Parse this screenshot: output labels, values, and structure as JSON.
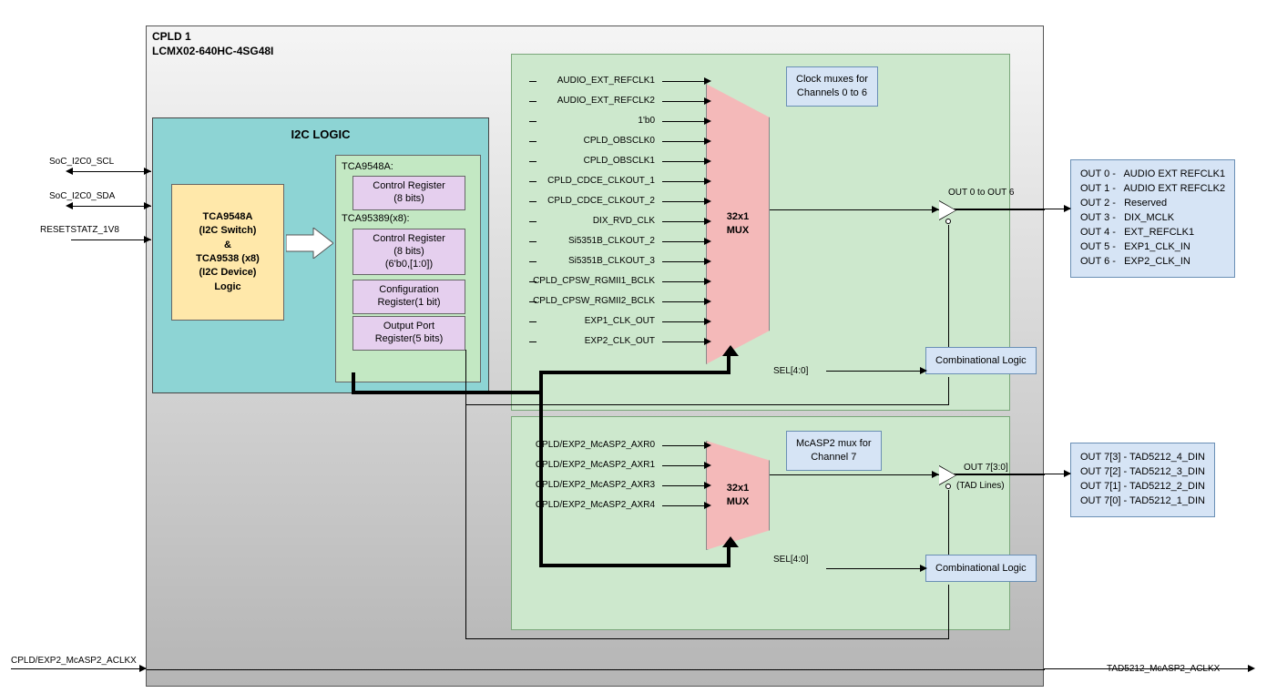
{
  "cpld": {
    "title_l1": "CPLD 1",
    "title_l2": "LCMX02-640HC-4SG48I"
  },
  "ext_inputs": {
    "scl": "SoC_I2C0_SCL",
    "sda": "SoC_I2C0_SDA",
    "rst": "RESETSTATZ_1V8",
    "aclkx": "CPLD/EXP2_McASP2_ACLKX"
  },
  "ext_outputs": {
    "aclkx_out": "TAD5212_McASP2_ACLKX"
  },
  "i2c_logic": {
    "title": "I2C LOGIC",
    "tca_block": "TCA9548A\n(I2C Switch)\n&\nTCA9538 (x8)\n(I2C Device)\nLogic",
    "tca9548a_label": "TCA9548A:",
    "ctrl_reg_a": "Control Register\n(8 bits)",
    "tca9538_label": "TCA95389(x8):",
    "ctrl_reg_b": "Control Register\n(8 bits)\n(6'b0,[1:0])",
    "cfg_reg": "Configuration\nRegister(1 bit)",
    "out_port_reg": "Output Port\nRegister(5 bits)"
  },
  "mux1": {
    "label_l1": "32x1",
    "label_l2": "MUX",
    "info": "Clock muxes for\nChannels 0 to 6",
    "sel": "SEL[4:0]",
    "comb": "Combinational Logic",
    "out_label": "OUT 0 to OUT 6",
    "inputs": [
      "AUDIO_EXT_REFCLK1",
      "AUDIO_EXT_REFCLK2",
      "1'b0",
      "CPLD_OBSCLK0",
      "CPLD_OBSCLK1",
      "CPLD_CDCE_CLKOUT_1",
      "CPLD_CDCE_CLKOUT_2",
      "DIX_RVD_CLK",
      "Si5351B_CLKOUT_2",
      "Si5351B_CLKOUT_3",
      "CPLD_CPSW_RGMII1_BCLK",
      "CPLD_CPSW_RGMII2_BCLK",
      "EXP1_CLK_OUT",
      "EXP2_CLK_OUT"
    ]
  },
  "mux2": {
    "label_l1": "32x1",
    "label_l2": "MUX",
    "info": "McASP2 mux for\nChannel 7",
    "sel": "SEL[4:0]",
    "comb": "Combinational Logic",
    "out_label": "OUT 7[3:0]",
    "out_sub": "(TAD Lines)",
    "inputs": [
      "CPLD/EXP2_McASP2_AXR0",
      "CPLD/EXP2_McASP2_AXR1",
      "CPLD/EXP2_McASP2_AXR3",
      "CPLD/EXP2_McASP2_AXR4"
    ]
  },
  "out_list1": "OUT 0 -   AUDIO EXT REFCLK1\nOUT 1 -   AUDIO EXT REFCLK2\nOUT 2 -   Reserved\nOUT 3 -   DIX_MCLK\nOUT 4 -   EXT_REFCLK1\nOUT 5 -   EXP1_CLK_IN\nOUT 6 -   EXP2_CLK_IN",
  "out_list2": "OUT 7[3] - TAD5212_4_DIN\nOUT 7[2] - TAD5212_3_DIN\nOUT 7[1] - TAD5212_2_DIN\nOUT 7[0] - TAD5212_1_DIN"
}
